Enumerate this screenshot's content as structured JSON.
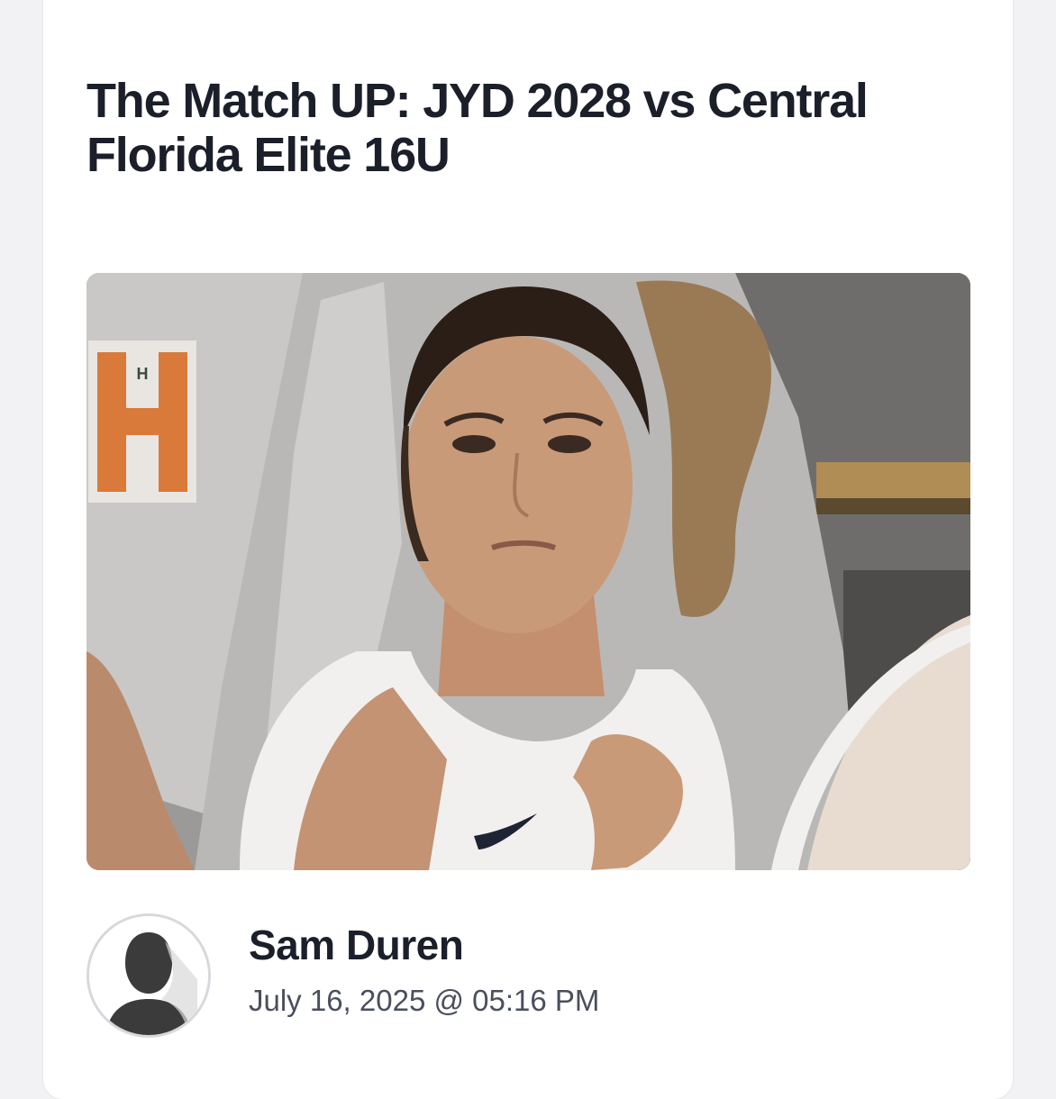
{
  "article": {
    "title": "The Match UP: JYD 2028 vs Central Florida Elite 16U",
    "image": {
      "subject": "basketball player photo",
      "jersey_letter": "H"
    }
  },
  "author": {
    "name": "Sam Duren",
    "date": "July 16, 2025 @ 05:16 PM",
    "avatar_icon": "default-user-silhouette-icon"
  },
  "colors": {
    "background": "#f2f2f4",
    "card": "#ffffff",
    "title_text": "#1b1f2a",
    "date_text": "#4a4f5c"
  }
}
